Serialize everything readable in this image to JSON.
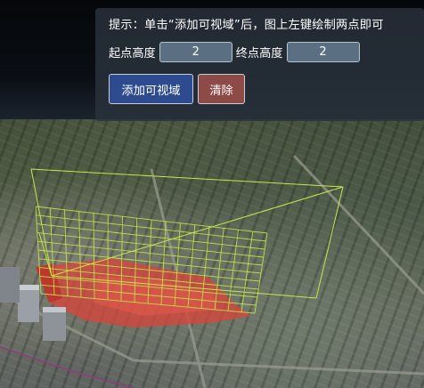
{
  "panel": {
    "hint": "提示：单击“添加可视域”后，图上左键绘制两点即可",
    "start_height_label": "起点高度",
    "start_height_value": "2",
    "end_height_label": "终点高度",
    "end_height_value": "2",
    "add_button_label": "添加可视域",
    "clear_button_label": "清除"
  },
  "colors": {
    "frustum_line": "#c6e84a",
    "occluded_area": "#d6453b",
    "add_button": "#2f4b8f",
    "clear_button": "#8e4a47"
  }
}
